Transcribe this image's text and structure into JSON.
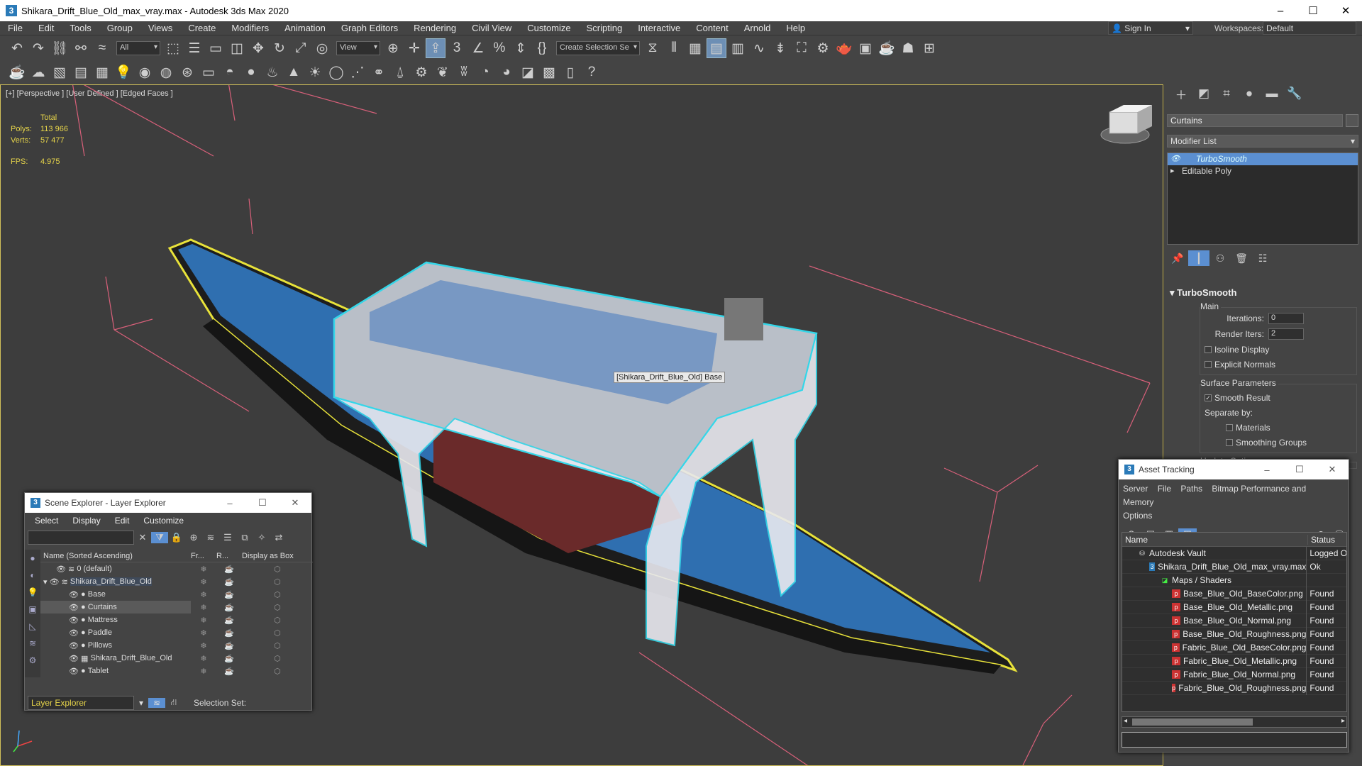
{
  "window": {
    "title": "Shikara_Drift_Blue_Old_max_vray.max - Autodesk 3ds Max 2020",
    "app_icon": "3"
  },
  "menu": [
    "File",
    "Edit",
    "Tools",
    "Group",
    "Views",
    "Create",
    "Modifiers",
    "Animation",
    "Graph Editors",
    "Rendering",
    "Civil View",
    "Customize",
    "Scripting",
    "Interactive",
    "Content",
    "Arnold",
    "Help"
  ],
  "account": {
    "sign_in": "Sign In",
    "workspaces_label": "Workspaces:",
    "workspace": "Default"
  },
  "toolbar": {
    "filter": "All",
    "view": "View",
    "selection_set": "Create Selection Se"
  },
  "viewport": {
    "label": "[+] [Perspective ] [User Defined ] [Edged Faces ]",
    "stats": {
      "header": "Total",
      "polys_label": "Polys:",
      "polys": "113 966",
      "verts_label": "Verts:",
      "verts": "57 477",
      "fps_label": "FPS:",
      "fps": "4.975"
    },
    "tooltip": "[Shikara_Drift_Blue_Old] Base"
  },
  "command_panel": {
    "object_name": "Curtains",
    "modifier_list": "Modifier List",
    "stack": [
      "TurboSmooth",
      "Editable Poly"
    ],
    "rollout": {
      "title": "TurboSmooth",
      "main": "Main",
      "iterations_label": "Iterations:",
      "iterations": "0",
      "render_iters_label": "Render Iters:",
      "render_iters": "2",
      "isoline": "Isoline Display",
      "explicit_normals": "Explicit Normals",
      "surface_params": "Surface Parameters",
      "smooth_result": "Smooth Result",
      "separate_by": "Separate by:",
      "materials": "Materials",
      "smoothing_groups": "Smoothing Groups",
      "update_options": "Update Options"
    }
  },
  "scene_explorer": {
    "title": "Scene Explorer - Layer Explorer",
    "menu": [
      "Select",
      "Display",
      "Edit",
      "Customize"
    ],
    "columns": [
      "Name (Sorted Ascending)",
      "Fr...",
      "R...",
      "Display as Box"
    ],
    "rows": [
      "0 (default)",
      "Shikara_Drift_Blue_Old",
      "Base",
      "Curtains",
      "Mattress",
      "Paddle",
      "Pillows",
      "Shikara_Drift_Blue_Old",
      "Tablet"
    ],
    "footer_explorer": "Layer Explorer",
    "selection_set": "Selection Set:"
  },
  "asset_tracking": {
    "title": "Asset Tracking",
    "menu": [
      "Server",
      "File",
      "Paths",
      "Bitmap Performance and Memory",
      "Options"
    ],
    "columns": [
      "Name",
      "Status"
    ],
    "rows": [
      {
        "name": "Autodesk Vault",
        "status": "Logged O"
      },
      {
        "name": "Shikara_Drift_Blue_Old_max_vray.max",
        "status": "Ok"
      },
      {
        "name": "Maps / Shaders",
        "status": ""
      },
      {
        "name": "Base_Blue_Old_BaseColor.png",
        "status": "Found"
      },
      {
        "name": "Base_Blue_Old_Metallic.png",
        "status": "Found"
      },
      {
        "name": "Base_Blue_Old_Normal.png",
        "status": "Found"
      },
      {
        "name": "Base_Blue_Old_Roughness.png",
        "status": "Found"
      },
      {
        "name": "Fabric_Blue_Old_BaseColor.png",
        "status": "Found"
      },
      {
        "name": "Fabric_Blue_Old_Metallic.png",
        "status": "Found"
      },
      {
        "name": "Fabric_Blue_Old_Normal.png",
        "status": "Found"
      },
      {
        "name": "Fabric_Blue_Old_Roughness.png",
        "status": "Found"
      }
    ]
  },
  "colors": {
    "selection": "#e8e23a",
    "highlight": "#35d6e8",
    "boat_blue": "#2f6fb0",
    "bounding_box": "#d8607a"
  }
}
